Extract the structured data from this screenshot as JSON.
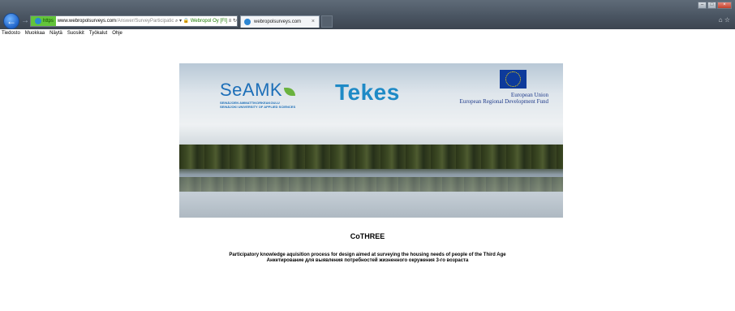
{
  "browser": {
    "address": {
      "scheme": "https",
      "host": "www.webropolsurveys.com",
      "path": "/Answer/SurveyParticipatio",
      "site_identity": "Webropol Oy [FI]"
    },
    "tab": {
      "title": "webropolsurveys.com",
      "close": "×"
    }
  },
  "menubar": {
    "items": [
      "Tiedosto",
      "Muokkaa",
      "Näytä",
      "Suosikit",
      "Työkalut",
      "Ohje"
    ]
  },
  "banner": {
    "seamk": {
      "name": "SeAMK",
      "sub1": "SEINÄJOEN AMMATTIKORKEAKOULU",
      "sub2": "SEINÄJOKI UNIVERSITY OF APPLIED SCIENCES"
    },
    "tekes": "Tekes",
    "eu": {
      "line1": "European Union",
      "line2": "European Regional Development Fund"
    }
  },
  "survey": {
    "title": "CoTHREE",
    "description_en": "Participatory knowledge aquisition process for design aimed at surveying the housing needs of people of the Third Age",
    "description_ru": "Анкетирование для выявления потребностей жизненного окружения 3-го возраста"
  },
  "colors": {
    "seamk_blue": "#1d6fb8",
    "seamk_green": "#6ab23e",
    "tekes_blue": "#1e8ac6",
    "eu_blue": "#0d3a9b"
  },
  "icons": [
    "back-icon",
    "forward-icon",
    "lock-icon",
    "search-icon",
    "refresh-icon",
    "home-icon",
    "favorites-star-icon"
  ]
}
